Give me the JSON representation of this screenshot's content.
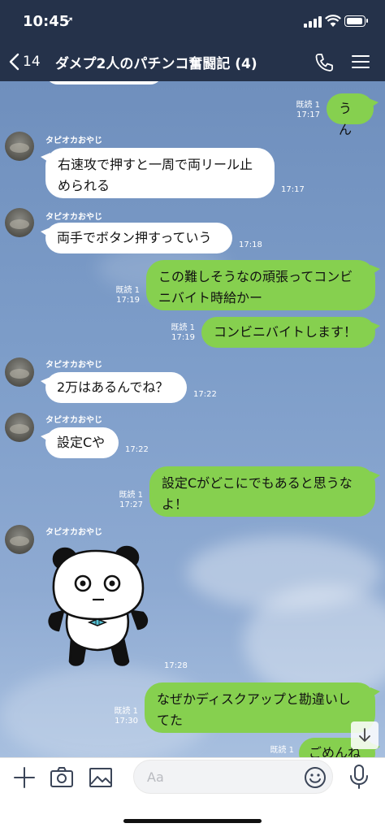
{
  "status_bar": {
    "time": "10:45"
  },
  "header": {
    "back_count": "14",
    "title": "ダメプ2人のパチンコ奮闘記 (4)"
  },
  "chat": {
    "contact_name": "タピオカおやじ",
    "messages": [
      {
        "id": "m1",
        "side": "out",
        "text": "うん",
        "read": "既読 1",
        "time": "17:17"
      },
      {
        "id": "m2",
        "side": "in",
        "name": "タピオカおやじ",
        "text": "右速攻で押すと一周で両リール止められる",
        "time": "17:17"
      },
      {
        "id": "m3",
        "side": "in",
        "name": "タピオカおやじ",
        "text": "両手でボタン押すっていう",
        "time": "17:18"
      },
      {
        "id": "m4",
        "side": "out",
        "text": "この難しそうなの頑張ってコンビニバイト時給かー",
        "read": "既読 1",
        "time": "17:19"
      },
      {
        "id": "m5",
        "side": "out",
        "text": "コンビニバイトします！",
        "read": "既読 1",
        "time": "17:19"
      },
      {
        "id": "m6",
        "side": "in",
        "name": "タピオカおやじ",
        "text": "2万はあるんでね？",
        "time": "17:22"
      },
      {
        "id": "m7",
        "side": "in",
        "name": "タピオカおやじ",
        "text": "設定Cや",
        "time": "17:22"
      },
      {
        "id": "m8",
        "side": "out",
        "text": "設定Cがどこにでもあると思うなよ！",
        "read": "既読 1",
        "time": "17:27"
      },
      {
        "id": "m9",
        "side": "in",
        "name": "タピオカおやじ",
        "sticker": "panda-sticker",
        "time": "17:28"
      },
      {
        "id": "m10",
        "side": "out",
        "text": "なぜかディスクアップと勘違いしてた",
        "read": "既読 1",
        "time": "17:30"
      },
      {
        "id": "m11",
        "side": "out",
        "text": "ごめんね",
        "read": "既読 1"
      }
    ]
  },
  "composer": {
    "placeholder": "Aa"
  },
  "icons": {
    "back": "chevron-left-icon",
    "call": "phone-icon",
    "menu": "hamburger-icon",
    "plus": "plus-icon",
    "camera": "camera-icon",
    "image": "image-icon",
    "emoji": "smiley-icon",
    "mic": "mic-icon",
    "scroll": "arrow-down-icon"
  },
  "colors": {
    "header": "#25324a",
    "outgoing": "#86d04f",
    "incoming": "#ffffff"
  }
}
